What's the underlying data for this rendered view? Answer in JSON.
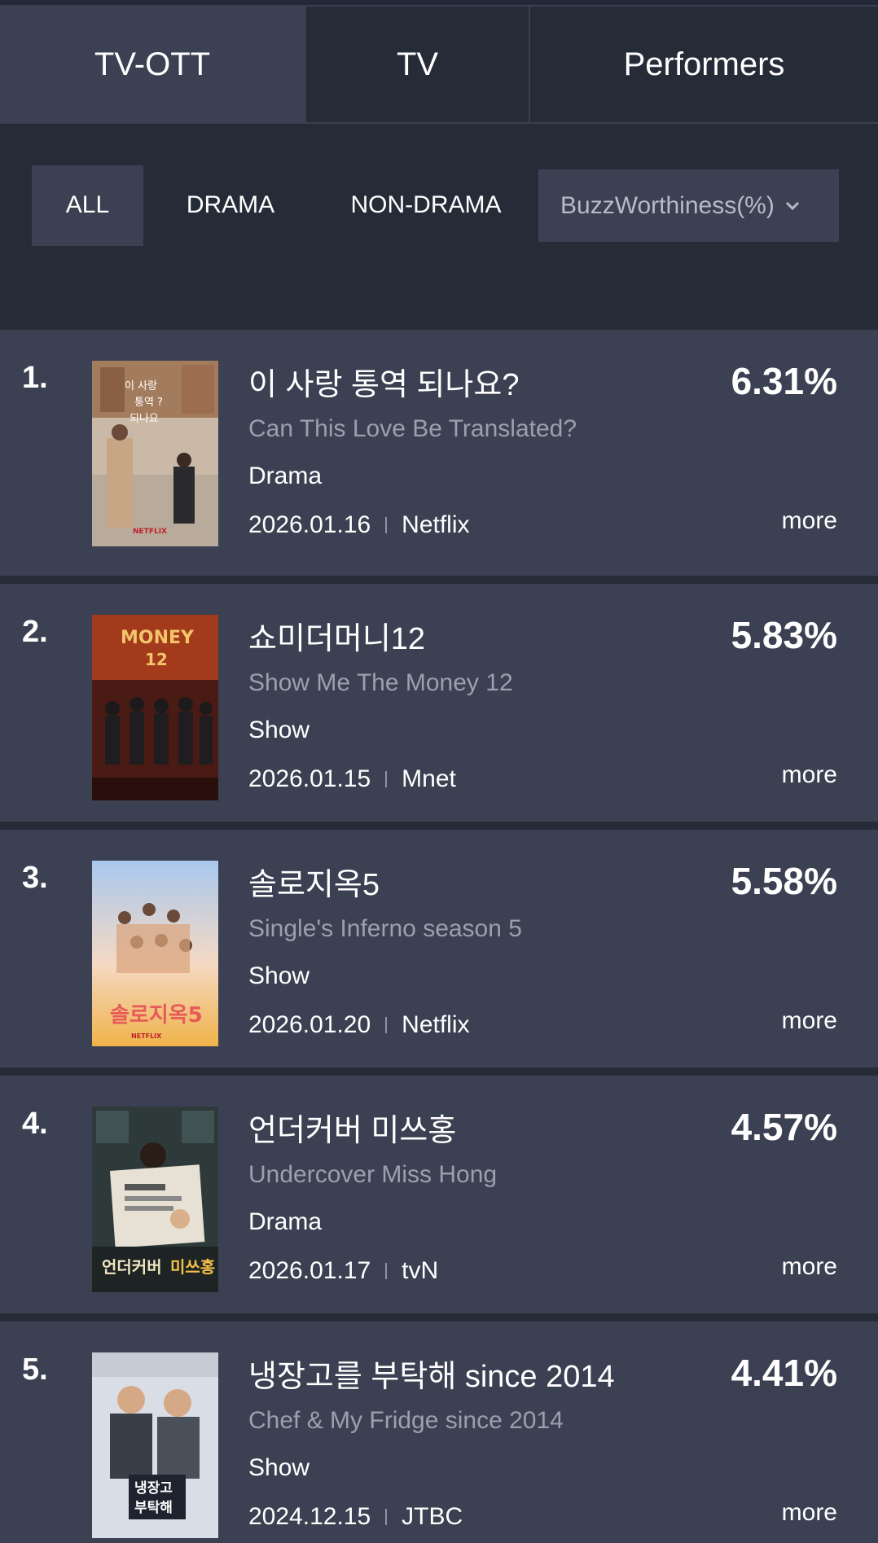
{
  "tabs": [
    {
      "label": "TV-OTT"
    },
    {
      "label": "TV"
    },
    {
      "label": "Performers"
    }
  ],
  "filters": {
    "all": "ALL",
    "drama": "DRAMA",
    "non_drama": "NON-DRAMA",
    "metric": "BuzzWorthiness(%)"
  },
  "items": [
    {
      "rank": "1.",
      "title_ko": "이 사랑 통역 되나요?",
      "title_en": "Can This Love Be Translated?",
      "genre": "Drama",
      "date": "2026.01.16",
      "channel": "Netflix",
      "percent": "6.31%",
      "more": "more"
    },
    {
      "rank": "2.",
      "title_ko": "쇼미더머니12",
      "title_en": "Show Me The Money 12",
      "genre": "Show",
      "date": "2026.01.15",
      "channel": "Mnet",
      "percent": "5.83%",
      "more": "more"
    },
    {
      "rank": "3.",
      "title_ko": "솔로지옥5",
      "title_en": "Single's Inferno season 5",
      "genre": "Show",
      "date": "2026.01.20",
      "channel": "Netflix",
      "percent": "5.58%",
      "more": "more"
    },
    {
      "rank": "4.",
      "title_ko": "언더커버 미쓰홍",
      "title_en": "Undercover Miss Hong",
      "genre": "Drama",
      "date": "2026.01.17",
      "channel": "tvN",
      "percent": "4.57%",
      "more": "more"
    },
    {
      "rank": "5.",
      "title_ko": "냉장고를 부탁해 since 2014",
      "title_en": "Chef & My Fridge since 2014",
      "genre": "Show",
      "date": "2024.12.15",
      "channel": "JTBC",
      "percent": "4.41%",
      "more": "more"
    }
  ]
}
